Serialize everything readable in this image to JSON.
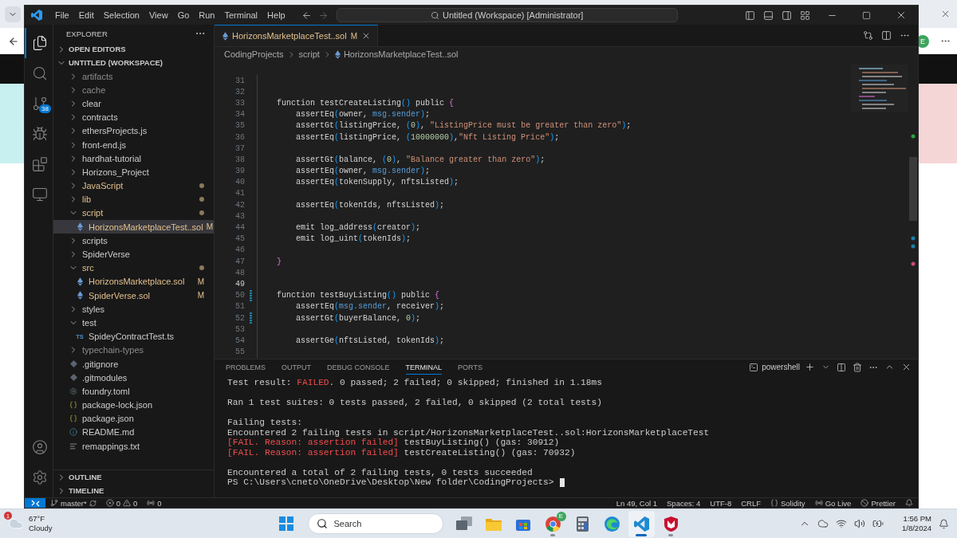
{
  "browser": {
    "profile": "E"
  },
  "window": {
    "menu": [
      "File",
      "Edit",
      "Selection",
      "View",
      "Go",
      "Run",
      "Terminal",
      "Help"
    ],
    "command_center": "Untitled (Workspace) [Administrator]"
  },
  "activity_bar": {
    "items": [
      {
        "kind": "files",
        "selected": true
      },
      {
        "kind": "search",
        "selected": false
      },
      {
        "kind": "source-control",
        "selected": false,
        "badge": "38"
      },
      {
        "kind": "run",
        "selected": false
      },
      {
        "kind": "extensions",
        "selected": false
      },
      {
        "kind": "remote",
        "selected": false
      }
    ],
    "bottom": [
      {
        "kind": "account"
      },
      {
        "kind": "settings"
      }
    ]
  },
  "sidebar": {
    "title": "EXPLORER",
    "sections": [
      {
        "label": "OPEN EDITORS",
        "expanded": false
      },
      {
        "label": "UNTITLED (WORKSPACE)",
        "expanded": true
      }
    ],
    "tree": [
      {
        "name": "artifacts",
        "kind": "folder",
        "expanded": false,
        "modified": false,
        "ignored": true,
        "selected": false
      },
      {
        "name": "cache",
        "kind": "folder",
        "expanded": false,
        "modified": false,
        "ignored": true,
        "selected": false
      },
      {
        "name": "clear",
        "kind": "folder",
        "expanded": false,
        "modified": false,
        "ignored": false,
        "selected": false
      },
      {
        "name": "contracts",
        "kind": "folder",
        "expanded": false,
        "modified": false,
        "ignored": false,
        "selected": false
      },
      {
        "name": "ethersProjects.js",
        "kind": "folder",
        "expanded": false,
        "modified": false,
        "ignored": false,
        "selected": false
      },
      {
        "name": "front-end.js",
        "kind": "folder",
        "expanded": false,
        "modified": false,
        "ignored": false,
        "selected": false
      },
      {
        "name": "hardhat-tutorial",
        "kind": "folder",
        "expanded": false,
        "modified": false,
        "ignored": false,
        "selected": false
      },
      {
        "name": "Horizons_Project",
        "kind": "folder",
        "expanded": false,
        "modified": false,
        "ignored": false,
        "selected": false
      },
      {
        "name": "JavaScript",
        "kind": "folder",
        "expanded": false,
        "modified": true,
        "ignored": false,
        "selected": false
      },
      {
        "name": "lib",
        "kind": "folder",
        "expanded": false,
        "modified": true,
        "ignored": false,
        "selected": false
      },
      {
        "name": "script",
        "kind": "folder",
        "expanded": true,
        "modified": true,
        "ignored": false,
        "selected": false,
        "children": [
          {
            "name": "HorizonsMarketplaceTest..sol",
            "kind": "sol",
            "modified": true,
            "ignored": false,
            "badge": "M",
            "selected": true
          }
        ]
      },
      {
        "name": "scripts",
        "kind": "folder",
        "expanded": false,
        "modified": false,
        "ignored": false,
        "selected": false
      },
      {
        "name": "SpiderVerse",
        "kind": "folder",
        "expanded": false,
        "modified": false,
        "ignored": false,
        "selected": false
      },
      {
        "name": "src",
        "kind": "folder",
        "expanded": true,
        "modified": true,
        "ignored": false,
        "selected": false,
        "children": [
          {
            "name": "HorizonsMarketplace.sol",
            "kind": "sol",
            "modified": true,
            "ignored": false,
            "badge": "M",
            "selected": false
          },
          {
            "name": "SpiderVerse.sol",
            "kind": "sol",
            "modified": true,
            "ignored": false,
            "badge": "M",
            "selected": false
          }
        ]
      },
      {
        "name": "styles",
        "kind": "folder",
        "expanded": false,
        "modified": false,
        "ignored": false,
        "selected": false
      },
      {
        "name": "test",
        "kind": "folder",
        "expanded": true,
        "modified": false,
        "ignored": false,
        "selected": false,
        "children": [
          {
            "name": "SpideyContractTest.ts",
            "kind": "ts",
            "icon_label": "TS",
            "modified": false,
            "ignored": false,
            "selected": false
          }
        ]
      },
      {
        "name": "typechain-types",
        "kind": "folder",
        "expanded": false,
        "modified": false,
        "ignored": true,
        "selected": false
      },
      {
        "name": ".gitignore",
        "kind": "git",
        "modified": false,
        "ignored": false,
        "selected": false
      },
      {
        "name": ".gitmodules",
        "kind": "git",
        "modified": false,
        "ignored": false,
        "selected": false
      },
      {
        "name": "foundry.toml",
        "kind": "gear",
        "modified": false,
        "ignored": false,
        "selected": false
      },
      {
        "name": "package-lock.json",
        "kind": "json",
        "modified": false,
        "ignored": false,
        "selected": false
      },
      {
        "name": "package.json",
        "kind": "json",
        "modified": false,
        "ignored": false,
        "selected": false
      },
      {
        "name": "README.md",
        "kind": "info",
        "modified": false,
        "ignored": false,
        "selected": false
      },
      {
        "name": "remappings.txt",
        "kind": "lines",
        "modified": false,
        "ignored": false,
        "selected": false
      }
    ],
    "bottom_sections": [
      {
        "label": "OUTLINE",
        "expanded": false
      },
      {
        "label": "TIMELINE",
        "expanded": false
      }
    ]
  },
  "editor": {
    "tabs": [
      {
        "label": "HorizonsMarketplaceTest..sol",
        "badge": "M",
        "selected": true
      }
    ],
    "breadcrumbs": [
      "CodingProjects",
      "script",
      "HorizonsMarketplaceTest..sol"
    ],
    "lines": [
      {
        "n": "31",
        "current": false,
        "modified": false
      },
      {
        "n": "32",
        "current": false,
        "modified": false
      },
      {
        "n": "33",
        "current": false,
        "modified": false,
        "t": "    function testCreateListing() public {"
      },
      {
        "n": "34",
        "current": false,
        "modified": false,
        "t": "        assertEq(owner, msg.sender);"
      },
      {
        "n": "35",
        "current": false,
        "modified": false,
        "t": "        assertGt(listingPrice, (0), \"ListingPrice must be greater than zero\");"
      },
      {
        "n": "36",
        "current": false,
        "modified": false,
        "t": "        assertEq(listingPrice, (10000000),\"Nft Listing Price\");"
      },
      {
        "n": "37",
        "current": false,
        "modified": false
      },
      {
        "n": "38",
        "current": false,
        "modified": false,
        "t": "        assertGt(balance, (0), \"Balance greater than zero\");"
      },
      {
        "n": "39",
        "current": false,
        "modified": false,
        "t": "        assertEq(owner, msg.sender);"
      },
      {
        "n": "40",
        "current": false,
        "modified": false,
        "t": "        assertEq(tokenSupply, nftsListed);"
      },
      {
        "n": "41",
        "current": false,
        "modified": false
      },
      {
        "n": "42",
        "current": false,
        "modified": false,
        "t": "        assertEq(tokenIds, nftsListed);"
      },
      {
        "n": "43",
        "current": false,
        "modified": false
      },
      {
        "n": "44",
        "current": false,
        "modified": false,
        "t": "        emit log_address(creator);"
      },
      {
        "n": "45",
        "current": false,
        "modified": false,
        "t": "        emit log_uint(tokenIds);"
      },
      {
        "n": "46",
        "current": false,
        "modified": false
      },
      {
        "n": "47",
        "current": false,
        "modified": false,
        "t": "    }"
      },
      {
        "n": "48",
        "current": false,
        "modified": false
      },
      {
        "n": "49",
        "current": true,
        "modified": false
      },
      {
        "n": "50",
        "current": false,
        "modified": true,
        "t": "    function testBuyListing() public {"
      },
      {
        "n": "51",
        "current": false,
        "modified": false,
        "t": "        assertEq(msg.sender, receiver);"
      },
      {
        "n": "52",
        "current": false,
        "modified": true,
        "t": "        assertGt(buyerBalance, 0);"
      },
      {
        "n": "53",
        "current": false,
        "modified": false
      },
      {
        "n": "54",
        "current": false,
        "modified": false,
        "t": "        assertGe(nftsListed, tokenIds);"
      },
      {
        "n": "55",
        "current": false,
        "modified": false
      }
    ]
  },
  "panel": {
    "tabs": [
      {
        "label": "PROBLEMS",
        "selected": false
      },
      {
        "label": "OUTPUT",
        "selected": false
      },
      {
        "label": "DEBUG CONSOLE",
        "selected": false
      },
      {
        "label": "TERMINAL",
        "selected": true
      },
      {
        "label": "PORTS",
        "selected": false
      }
    ],
    "terminal_name": "powershell",
    "blocks": [
      [
        "Test result: FAILED. 0 passed; 2 failed; 0 skipped; finished in 1.18ms"
      ],
      [
        "Ran 1 test suites: 0 tests passed, 2 failed, 0 skipped (2 total tests)"
      ],
      [
        "Failing tests:",
        "Encountered 2 failing tests in script/HorizonsMarketplaceTest..sol:HorizonsMarketplaceTest",
        "[FAIL. Reason: assertion failed] testBuyListing() (gas: 30912)",
        "[FAIL. Reason: assertion failed] testCreateListing() (gas: 70932)"
      ],
      [
        "Encountered a total of 2 failing tests, 0 tests succeeded",
        "PS C:\\Users\\cneto\\OneDrive\\Desktop\\New folder\\CodingProjects>"
      ]
    ]
  },
  "status_bar": {
    "branch": "master*",
    "errors": "0",
    "warnings": "0",
    "ports": "0",
    "items": [
      {
        "kind": "text",
        "label": "Ln 49, Col 1"
      },
      {
        "kind": "text",
        "label": "Spaces: 4"
      },
      {
        "kind": "text",
        "label": "UTF-8"
      },
      {
        "kind": "text",
        "label": "CRLF"
      },
      {
        "kind": "language",
        "label": "Solidity"
      },
      {
        "kind": "live",
        "label": "Go Live"
      },
      {
        "kind": "prettier",
        "label": "Prettier"
      }
    ]
  },
  "taskbar": {
    "weather": {
      "temperature": "67°F",
      "condition": "Cloudy",
      "badge": "1"
    },
    "search": {
      "placeholder": "Search"
    },
    "apps": [
      {
        "kind": "start",
        "running": false,
        "selected": false
      },
      {
        "kind": "task-view",
        "running": false,
        "selected": false
      },
      {
        "kind": "files",
        "running": false,
        "selected": false
      },
      {
        "kind": "store",
        "running": false,
        "selected": false
      },
      {
        "kind": "chrome",
        "running": true,
        "selected": false,
        "badge": "E"
      },
      {
        "kind": "calculator",
        "running": false,
        "selected": false
      },
      {
        "kind": "edge",
        "running": false,
        "selected": false
      },
      {
        "kind": "vscode",
        "running": true,
        "selected": true
      },
      {
        "kind": "mcafee",
        "running": true,
        "selected": false
      }
    ],
    "clock": {
      "time": "1:56 PM",
      "date": "1/8/2024"
    }
  }
}
